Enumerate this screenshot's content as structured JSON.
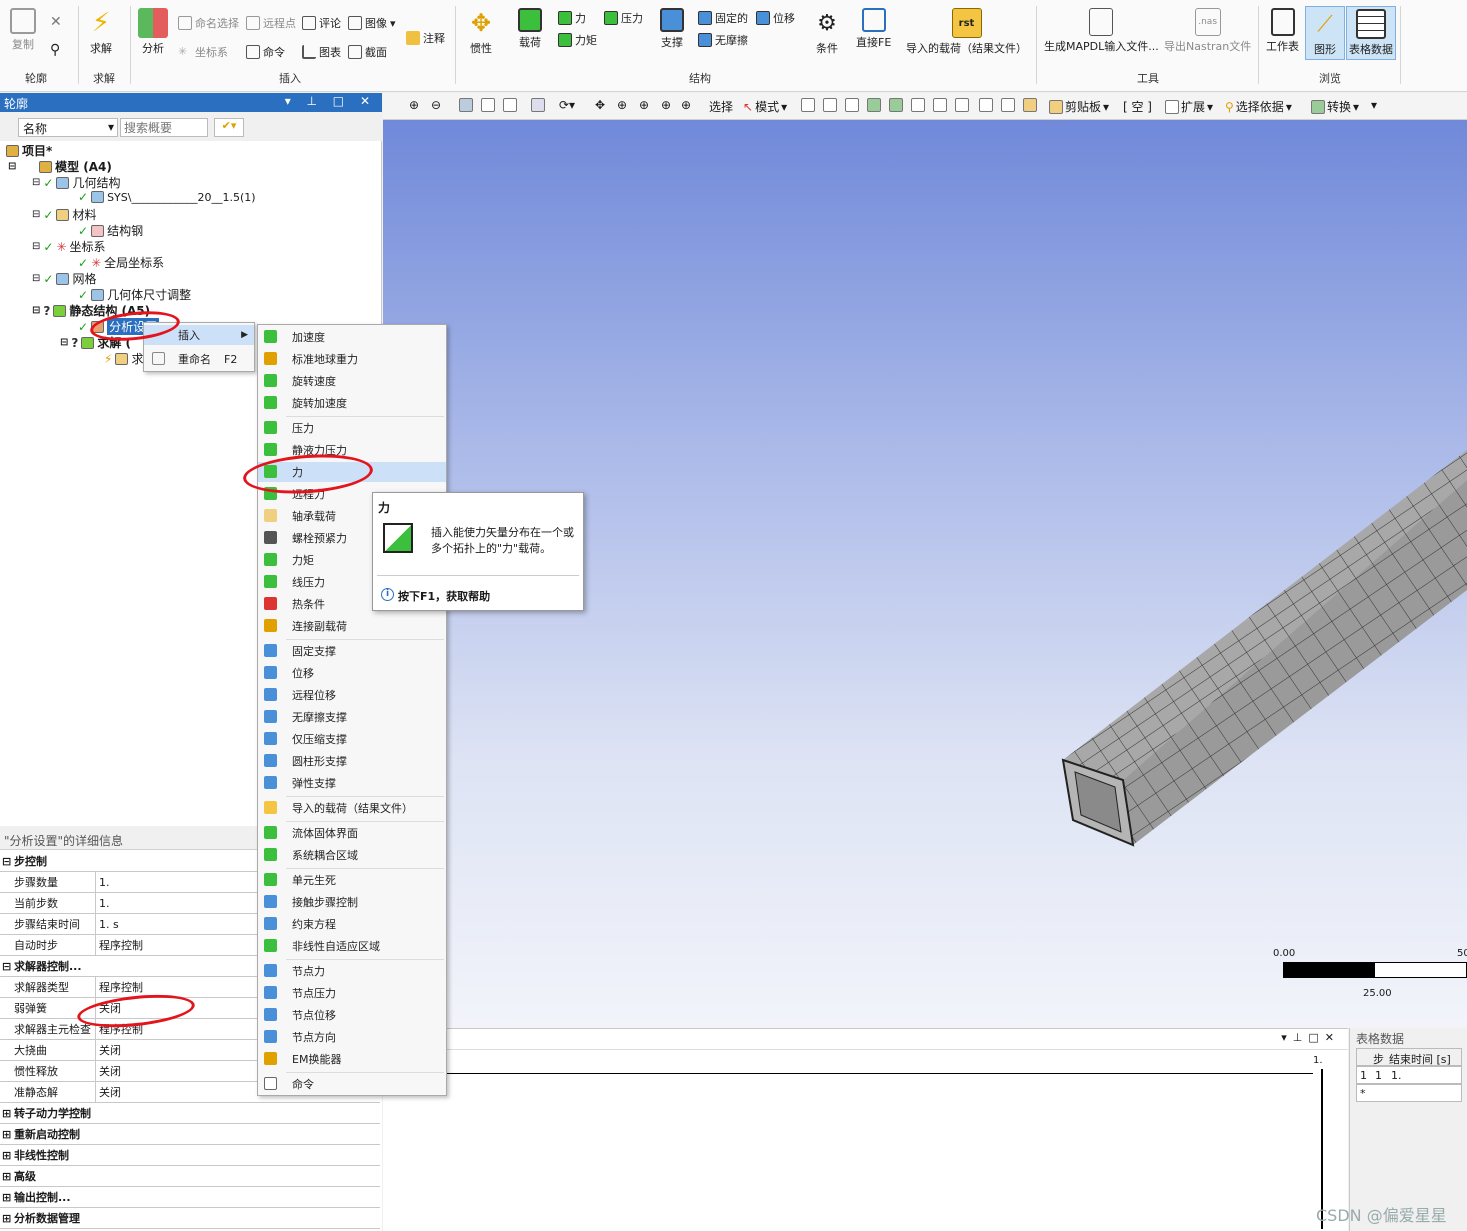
{
  "ribbon": {
    "groups": [
      {
        "label": "轮廓",
        "items": [
          {
            "label": "复制",
            "icon": "copy-icon"
          },
          {
            "label": "",
            "icon": "search-icon"
          },
          {
            "label": "",
            "icon": "close-icon"
          }
        ]
      },
      {
        "label": "求解",
        "items": [
          {
            "label": "求解",
            "icon": "lightning-icon"
          }
        ]
      },
      {
        "label": "插入",
        "items": [
          {
            "label": "分析",
            "icon": "analysis-icon"
          },
          {
            "label": "命名选择",
            "icon": "named-selection-icon"
          },
          {
            "label": "远程点",
            "icon": "remote-point-icon"
          },
          {
            "label": "评论",
            "icon": "comment-icon"
          },
          {
            "label": "图像",
            "icon": "image-icon"
          },
          {
            "label": "注释",
            "icon": "annotation-icon"
          },
          {
            "label": "坐标系",
            "icon": "coordinate-icon"
          },
          {
            "label": "命令",
            "icon": "command-icon"
          },
          {
            "label": "图表",
            "icon": "chart-icon"
          },
          {
            "label": "截面",
            "icon": "section-icon"
          }
        ]
      },
      {
        "label": "结构",
        "items": [
          {
            "label": "惯性",
            "icon": "inertia-icon"
          },
          {
            "label": "载荷",
            "icon": "load-icon"
          },
          {
            "label": "力",
            "icon": "force-icon"
          },
          {
            "label": "压力",
            "icon": "pressure-icon"
          },
          {
            "label": "力矩",
            "icon": "moment-icon"
          },
          {
            "label": "支撑",
            "icon": "support-icon"
          },
          {
            "label": "固定的",
            "icon": "fixed-icon"
          },
          {
            "label": "位移",
            "icon": "displacement-icon"
          },
          {
            "label": "无摩擦",
            "icon": "frictionless-icon"
          },
          {
            "label": "条件",
            "icon": "condition-icon"
          },
          {
            "label": "直接FE",
            "icon": "direct-fe-icon"
          },
          {
            "label": "导入的载荷（结果文件）",
            "icon": "rst-icon",
            "badge": "rst"
          }
        ]
      },
      {
        "label": "工具",
        "items": [
          {
            "label": "生成MAPDL输入文件...",
            "icon": "mapdl-icon"
          },
          {
            "label": "导出Nastran文件",
            "icon": "nastran-icon",
            "badge": ".nas"
          }
        ]
      },
      {
        "label": "浏览",
        "items": [
          {
            "label": "工作表",
            "icon": "worksheet-icon"
          },
          {
            "label": "图形",
            "icon": "graph-icon"
          },
          {
            "label": "表格数据",
            "icon": "table-icon"
          }
        ]
      }
    ]
  },
  "outline": {
    "title": "轮廓",
    "filter_label": "名称",
    "search_placeholder": "搜索概要",
    "tree": [
      {
        "label": "项目*",
        "bold": true
      },
      {
        "label": "模型 (A4)",
        "bold": true
      },
      {
        "label": "几何结构"
      },
      {
        "label": "SYS\\____________20__1.5(1)"
      },
      {
        "label": "材料"
      },
      {
        "label": "结构钢"
      },
      {
        "label": "坐标系"
      },
      {
        "label": "全局坐标系"
      },
      {
        "label": "网格"
      },
      {
        "label": "几何体尺寸调整"
      },
      {
        "label": "静态结构 (A5)",
        "bold": true
      },
      {
        "label": "分析设置"
      },
      {
        "label": "求解 ("
      },
      {
        "label": "求"
      }
    ]
  },
  "context_menu": {
    "items": [
      {
        "label": "插入",
        "shortcut": ""
      },
      {
        "label": "重命名",
        "shortcut": "F2"
      }
    ]
  },
  "insert_menu": {
    "items": [
      {
        "label": "加速度",
        "icon": "acceleration-icon"
      },
      {
        "label": "标准地球重力",
        "icon": "gravity-icon"
      },
      {
        "label": "旋转速度",
        "icon": "rotational-velocity-icon"
      },
      {
        "label": "旋转加速度",
        "icon": "rotational-acceleration-icon"
      },
      {
        "label": "压力",
        "icon": "pressure-icon"
      },
      {
        "label": "静液力压力",
        "icon": "hydrostatic-pressure-icon"
      },
      {
        "label": "力",
        "icon": "force-icon"
      },
      {
        "label": "远程力",
        "icon": "remote-force-icon"
      },
      {
        "label": "轴承载荷",
        "icon": "bearing-load-icon"
      },
      {
        "label": "螺栓预紧力",
        "icon": "bolt-pretension-icon"
      },
      {
        "label": "力矩",
        "icon": "moment-icon"
      },
      {
        "label": "线压力",
        "icon": "line-pressure-icon"
      },
      {
        "label": "热条件",
        "icon": "thermal-condition-icon"
      },
      {
        "label": "连接副载荷",
        "icon": "joint-load-icon"
      },
      {
        "label": "固定支撑",
        "icon": "fixed-support-icon"
      },
      {
        "label": "位移",
        "icon": "displacement-icon"
      },
      {
        "label": "远程位移",
        "icon": "remote-displacement-icon"
      },
      {
        "label": "无摩擦支撑",
        "icon": "frictionless-support-icon"
      },
      {
        "label": "仅压缩支撑",
        "icon": "compression-only-icon"
      },
      {
        "label": "圆柱形支撑",
        "icon": "cylindrical-support-icon"
      },
      {
        "label": "弹性支撑",
        "icon": "elastic-support-icon"
      },
      {
        "label": "导入的载荷（结果文件）",
        "icon": "imported-load-icon"
      },
      {
        "label": "流体固体界面",
        "icon": "fluid-solid-interface-icon"
      },
      {
        "label": "系统耦合区域",
        "icon": "system-coupling-icon"
      },
      {
        "label": "单元生死",
        "icon": "element-birth-death-icon"
      },
      {
        "label": "接触步骤控制",
        "icon": "contact-step-icon"
      },
      {
        "label": "约束方程",
        "icon": "constraint-equation-icon"
      },
      {
        "label": "非线性自适应区域",
        "icon": "nonlinear-adaptive-icon"
      },
      {
        "label": "节点力",
        "icon": "nodal-force-icon"
      },
      {
        "label": "节点压力",
        "icon": "nodal-pressure-icon"
      },
      {
        "label": "节点位移",
        "icon": "nodal-displacement-icon"
      },
      {
        "label": "节点方向",
        "icon": "nodal-orientation-icon"
      },
      {
        "label": "EM换能器",
        "icon": "em-transducer-icon"
      },
      {
        "label": "命令",
        "icon": "command-icon"
      }
    ]
  },
  "tooltip": {
    "title": "力",
    "description": "插入能使力矢量分布在一个或多个拓扑上的\"力\"载荷。",
    "help": "按下F1，获取帮助"
  },
  "details": {
    "title": "\"分析设置\"的详细信息",
    "rows": [
      {
        "key": "步控制",
        "section": true
      },
      {
        "key": "步骤数量",
        "value": "1."
      },
      {
        "key": "当前步数",
        "value": "1."
      },
      {
        "key": "步骤结束时间",
        "value": "1. s"
      },
      {
        "key": "自动时步",
        "value": "程序控制"
      },
      {
        "key": "求解器控制...",
        "section": true
      },
      {
        "key": "求解器类型",
        "value": "程序控制"
      },
      {
        "key": "弱弹簧",
        "value": "关闭"
      },
      {
        "key": "求解器主元检查",
        "value": "程序控制"
      },
      {
        "key": "大挠曲",
        "value": "关闭"
      },
      {
        "key": "惯性释放",
        "value": "关闭"
      },
      {
        "key": "准静态解",
        "value": "关闭"
      },
      {
        "key": "转子动力学控制",
        "section": true
      },
      {
        "key": "重新启动控制",
        "section": true
      },
      {
        "key": "非线性控制",
        "section": true
      },
      {
        "key": "高级",
        "section": true
      },
      {
        "key": "输出控制...",
        "section": true
      },
      {
        "key": "分析数据管理",
        "section": true
      }
    ]
  },
  "graphics_toolbar": {
    "select_label": "选择",
    "mode_label": "模式",
    "clipboard_label": "剪贴板",
    "empty_label": "[ 空 ]",
    "extend_label": "扩展",
    "select_by_label": "选择依据",
    "convert_label": "转换"
  },
  "scale_bar": {
    "left": "0.00",
    "right": "50",
    "mid": "25.00"
  },
  "graph_panel": {
    "axis_value": "1."
  },
  "table_panel": {
    "title": "表格数据",
    "headers": [
      "步",
      "结束时间 [s]"
    ],
    "rows": [
      [
        "1",
        "1",
        "1."
      ],
      [
        "*",
        "",
        ""
      ]
    ]
  },
  "watermark": "CSDN @偏爱星星",
  "colors": {
    "accent": "#2a6fc0",
    "highlight": "#cce0f7",
    "annotation": "#e3141c",
    "viewport_top": "#7089d9"
  }
}
